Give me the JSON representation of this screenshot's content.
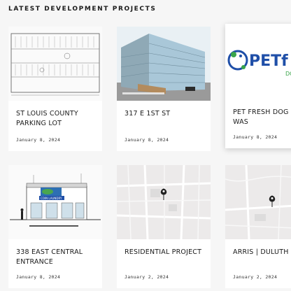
{
  "section": {
    "heading": "LATEST DEVELOPMENT PROJECTS"
  },
  "projects": [
    {
      "title": "ST LOUIS COUNTY PARKING LOT",
      "date": "January 8, 2024"
    },
    {
      "title": "317 E 1ST ST",
      "date": "January 8, 2024"
    },
    {
      "title": "PET FRESH DOG WAS",
      "date": "January 8, 2024",
      "logo_text": "PETf",
      "logo_sub": "DO"
    },
    {
      "title": "338 EAST CENTRAL ENTRANCE",
      "date": "January 8, 2024",
      "sign_text": "COIN LAUNDRY"
    },
    {
      "title": "RESIDENTIAL PROJECT",
      "date": "January 2, 2024"
    },
    {
      "title": "ARRIS | DULUTH",
      "date": "January 2, 2024"
    }
  ],
  "colors": {
    "logo_blue": "#1f4fa8",
    "logo_green": "#3aa54a",
    "glass": "#a9c7d8"
  }
}
